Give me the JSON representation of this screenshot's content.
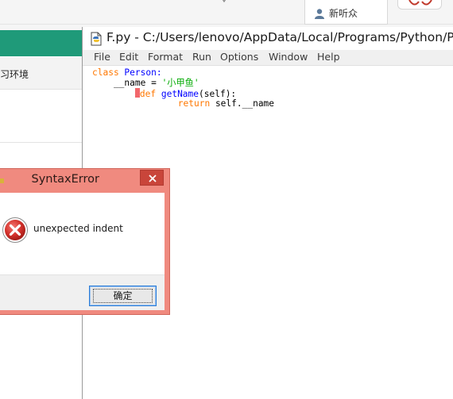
{
  "background": {
    "tab_label": "新听众",
    "sidebar_label": "习环境",
    "accent_color": "#1f9a79"
  },
  "idle": {
    "title": "F.py - C:/Users/lenovo/AppData/Local/Programs/Python/Pyt",
    "menu": [
      "File",
      "Edit",
      "Format",
      "Run",
      "Options",
      "Window",
      "Help"
    ],
    "code": {
      "line1_kw": "class",
      "line1_name": " Person:",
      "line2_pre": "    __name = ",
      "line2_str": "'小甲鱼'",
      "line3_kw": "def",
      "line3_name": "getName",
      "line3_rest": "(self):",
      "line4_kw": "return",
      "line4_rest": " self.__name"
    }
  },
  "dialog": {
    "title": "SyntaxError",
    "message": "unexpected indent",
    "ok_label": "确定",
    "frame_color": "#f08a7f",
    "close_color": "#c9453a"
  }
}
